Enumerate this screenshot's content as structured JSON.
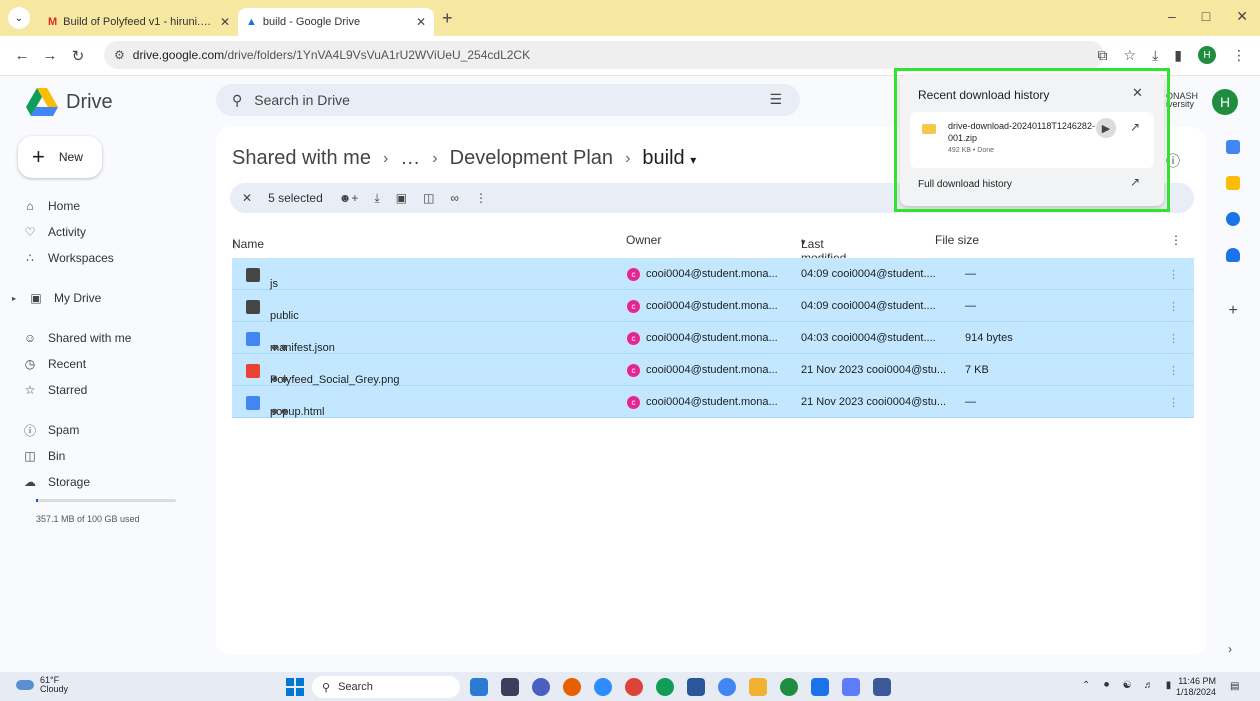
{
  "browser": {
    "tabs": [
      {
        "title": "Build of Polyfeed v1 - hiruni.pal",
        "active": false
      },
      {
        "title": "build - Google Drive",
        "active": true
      }
    ],
    "url_prefix": "drive.google.com",
    "url_path": "/drive/folders/1YnVA4L9VsVuA1rU2WViUeU_254cdL2CK",
    "profile_initial": "H"
  },
  "drive": {
    "app_name": "Drive",
    "search_placeholder": "Search in Drive",
    "new_label": "New",
    "org_logo": "ONASH",
    "org_logo_sub": "iversity",
    "avatar_initial": "H",
    "nav": [
      {
        "label": "Home",
        "icon": "home-icon"
      },
      {
        "label": "Activity",
        "icon": "bell-icon"
      },
      {
        "label": "Workspaces",
        "icon": "workspaces-icon"
      },
      {
        "label": "My Drive",
        "icon": "my-drive-icon"
      },
      {
        "label": "Shared with me",
        "icon": "people-icon"
      },
      {
        "label": "Recent",
        "icon": "clock-icon"
      },
      {
        "label": "Starred",
        "icon": "star-icon"
      },
      {
        "label": "Spam",
        "icon": "spam-icon"
      },
      {
        "label": "Bin",
        "icon": "trash-icon"
      },
      {
        "label": "Storage",
        "icon": "cloud-icon"
      }
    ],
    "storage_text": "357.1 MB of 100 GB used",
    "storage_fraction": 0.0036
  },
  "breadcrumb": {
    "root": "Shared with me",
    "ellipsis": "…",
    "parent": "Development Plan",
    "current": "build"
  },
  "selection": {
    "count_label": "5 selected"
  },
  "columns": {
    "name": "Name",
    "owner": "Owner",
    "modified": "Last modified",
    "size": "File size"
  },
  "files": [
    {
      "name": "js",
      "type": "folder",
      "shared": false,
      "owner": "cooi0004@student.mona...",
      "modified": "04:09 cooi0004@student....",
      "size": "—"
    },
    {
      "name": "public",
      "type": "folder",
      "shared": false,
      "owner": "cooi0004@student.mona...",
      "modified": "04:09 cooi0004@student....",
      "size": "—"
    },
    {
      "name": "manifest.json",
      "type": "doc",
      "shared": true,
      "owner": "cooi0004@student.mona...",
      "modified": "04:03 cooi0004@student....",
      "size": "914 bytes"
    },
    {
      "name": "Polyfeed_Social_Grey.png",
      "type": "img",
      "shared": true,
      "owner": "cooi0004@student.mona...",
      "modified": "21 Nov 2023 cooi0004@stu...",
      "size": "7 KB"
    },
    {
      "name": "popup.html",
      "type": "doc",
      "shared": true,
      "owner": "cooi0004@student.mona...",
      "modified": "21 Nov 2023 cooi0004@stu...",
      "size": "—"
    }
  ],
  "downloads": {
    "title": "Recent download history",
    "file_name": "drive-download-20240118T1246282-001.zip",
    "meta": "492 KB • Done",
    "full_history": "Full download history"
  },
  "taskbar": {
    "temp": "61°F",
    "weather": "Cloudy",
    "search": "Search",
    "time": "11:46 PM",
    "date": "1/18/2024"
  }
}
